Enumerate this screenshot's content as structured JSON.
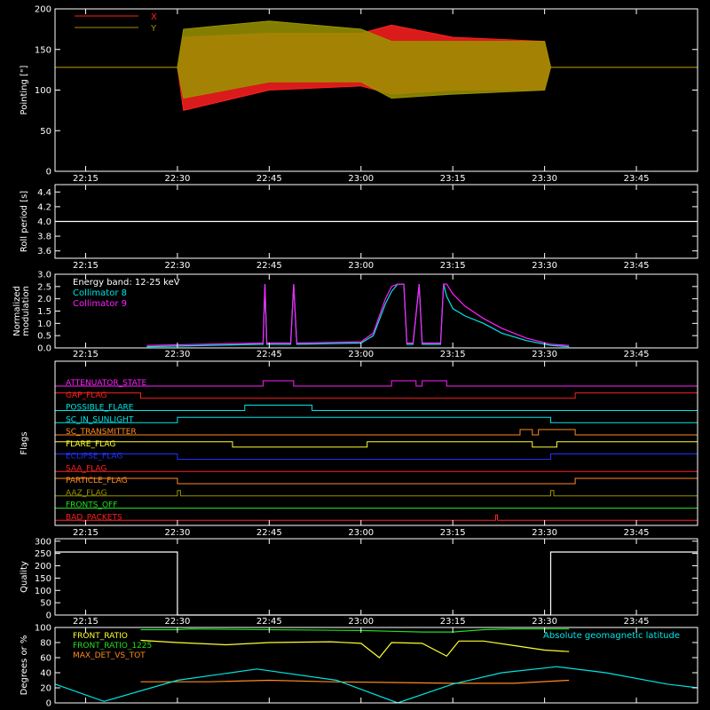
{
  "x_ticks": [
    "22:15",
    "22:30",
    "22:45",
    "23:00",
    "23:15",
    "23:30",
    "23:45"
  ],
  "colors": {
    "background": "#000000",
    "axis": "#ffffff",
    "red": "#ff2020",
    "olive": "#9a9400",
    "cyan": "#00e5e5",
    "magenta": "#ff20ff",
    "yellow": "#ffff30",
    "green": "#20e020",
    "orange": "#ff8a20",
    "blue": "#2030ff"
  },
  "chart_data": [
    {
      "id": "pointing",
      "type": "line",
      "ylabel": "Pointing [\"]",
      "ylim": [
        0,
        200
      ],
      "yticks": [
        "0",
        "50",
        "100",
        "150",
        "200"
      ],
      "x_range": [
        "22:10",
        "23:55"
      ],
      "legend": [
        {
          "name": "X",
          "color": "#ff2020"
        },
        {
          "name": "Y",
          "color": "#9a9400"
        }
      ],
      "legend_position": "top-left",
      "series": [
        {
          "name": "X",
          "color": "#ff2020",
          "x": [
            "22:10",
            "22:30",
            "22:31",
            "22:45",
            "23:00",
            "23:05",
            "23:15",
            "23:30",
            "23:31",
            "23:55"
          ],
          "ymin": [
            128,
            128,
            75,
            100,
            105,
            95,
            100,
            100,
            128,
            128
          ],
          "ymax": [
            128,
            128,
            165,
            170,
            170,
            180,
            165,
            160,
            128,
            128
          ]
        },
        {
          "name": "Y",
          "color": "#9a9400",
          "x": [
            "22:10",
            "22:30",
            "22:31",
            "22:45",
            "23:00",
            "23:05",
            "23:15",
            "23:30",
            "23:31",
            "23:55"
          ],
          "ymin": [
            128,
            128,
            90,
            110,
            110,
            90,
            95,
            100,
            128,
            128
          ],
          "ymax": [
            128,
            128,
            175,
            185,
            175,
            160,
            160,
            160,
            128,
            128
          ]
        }
      ]
    },
    {
      "id": "roll",
      "type": "line",
      "ylabel": "Roll period [s]",
      "ylim": [
        3.5,
        4.5
      ],
      "yticks": [
        "3.6",
        "3.8",
        "4.0",
        "4.2",
        "4.4"
      ],
      "series": [
        {
          "name": "",
          "color": "#ffffff",
          "x": [
            "22:10",
            "23:55"
          ],
          "y": [
            4.0,
            4.0
          ]
        }
      ]
    },
    {
      "id": "modulation",
      "type": "line",
      "ylabel": "Normalized modulation",
      "ylim": [
        0,
        3.0
      ],
      "yticks": [
        "0.0",
        "0.5",
        "1.0",
        "1.5",
        "2.0",
        "2.5",
        "3.0"
      ],
      "annotation": "Energy band: 12-25 keV",
      "legend": [
        {
          "name": "Collimator 8",
          "color": "#00e5e5"
        },
        {
          "name": "Collimator 9",
          "color": "#ff20ff"
        }
      ],
      "legend_position": "top-left",
      "series": [
        {
          "name": "Collimator 8",
          "color": "#00e5e5",
          "x": [
            "22:25",
            "22:44",
            "22:44.3",
            "22:44.6",
            "22:48.5",
            "22:49",
            "22:49.5",
            "23:00",
            "23:02",
            "23:04",
            "23:05",
            "23:06",
            "23:07",
            "23:07.5",
            "23:08.5",
            "23:09.5",
            "23:10",
            "23:11",
            "23:13",
            "23:13.5",
            "23:14",
            "23:15",
            "23:17",
            "23:20",
            "23:23",
            "23:27",
            "23:31",
            "23:34"
          ],
          "y": [
            0.05,
            0.15,
            2.6,
            0.15,
            0.15,
            2.6,
            0.15,
            0.2,
            0.5,
            1.8,
            2.3,
            2.6,
            2.6,
            0.15,
            0.15,
            2.6,
            0.15,
            0.15,
            0.15,
            2.6,
            2.1,
            1.6,
            1.3,
            1.0,
            0.6,
            0.3,
            0.1,
            0.05
          ]
        },
        {
          "name": "Collimator 9",
          "color": "#ff20ff",
          "x": [
            "22:25",
            "22:44",
            "22:44.3",
            "22:44.6",
            "22:48.5",
            "22:49",
            "22:49.5",
            "23:00",
            "23:02",
            "23:04",
            "23:05",
            "23:06",
            "23:07",
            "23:07.5",
            "23:08.5",
            "23:09.5",
            "23:10",
            "23:11",
            "23:13",
            "23:13.5",
            "23:14",
            "23:15",
            "23:17",
            "23:20",
            "23:23",
            "23:27",
            "23:31",
            "23:34"
          ],
          "y": [
            0.1,
            0.2,
            2.6,
            0.2,
            0.2,
            2.6,
            0.2,
            0.25,
            0.6,
            2.0,
            2.5,
            2.6,
            2.6,
            0.2,
            0.2,
            2.6,
            0.2,
            0.2,
            0.2,
            2.6,
            2.6,
            2.2,
            1.7,
            1.2,
            0.8,
            0.4,
            0.15,
            0.1
          ]
        }
      ]
    },
    {
      "id": "flags",
      "type": "line",
      "ylabel": "Flags",
      "flags": [
        {
          "name": "ATTENUATOR_STATE",
          "color": "#ff20ff",
          "x": [
            "22:10",
            "22:44",
            "22:44",
            "22:49",
            "22:49",
            "23:05",
            "23:05",
            "23:09",
            "23:09",
            "23:10",
            "23:10",
            "23:14",
            "23:14",
            "23:55"
          ],
          "v": [
            0,
            0,
            1,
            1,
            0,
            0,
            1,
            1,
            0,
            0,
            1,
            1,
            0,
            0
          ]
        },
        {
          "name": "GAP_FLAG",
          "color": "#ff2020",
          "x": [
            "22:10",
            "22:24",
            "22:24",
            "23:35",
            "23:35",
            "23:55"
          ],
          "v": [
            1,
            1,
            0,
            0,
            1,
            1
          ]
        },
        {
          "name": "POSSIBLE_FLARE",
          "color": "#00e5e5",
          "x": [
            "22:10",
            "22:41",
            "22:41",
            "22:52",
            "22:52",
            "23:55"
          ],
          "v": [
            0,
            0,
            1,
            1,
            0,
            0
          ]
        },
        {
          "name": "SC_IN_SUNLIGHT",
          "color": "#00e5e5",
          "x": [
            "22:10",
            "22:30",
            "22:30",
            "23:31",
            "23:31",
            "23:55"
          ],
          "v": [
            0,
            0,
            1,
            1,
            0,
            0
          ]
        },
        {
          "name": "SC_TRANSMITTER",
          "color": "#ff8a20",
          "x": [
            "22:10",
            "23:26",
            "23:26",
            "23:28",
            "23:28",
            "23:29",
            "23:29",
            "23:35",
            "23:35",
            "23:55"
          ],
          "v": [
            0,
            0,
            1,
            1,
            0,
            0,
            1,
            1,
            0,
            0
          ]
        },
        {
          "name": "FLARE_FLAG",
          "color": "#ffff30",
          "x": [
            "22:10",
            "22:39",
            "22:39",
            "23:01",
            "23:01",
            "23:28",
            "23:28",
            "23:32",
            "23:32",
            "23:55"
          ],
          "v": [
            1,
            1,
            0,
            0,
            1,
            1,
            0,
            0,
            1,
            1
          ]
        },
        {
          "name": "ECLIPSE_FLAG",
          "color": "#2030ff",
          "x": [
            "22:10",
            "22:30",
            "22:30",
            "23:31",
            "23:31",
            "23:55"
          ],
          "v": [
            1,
            1,
            0,
            0,
            1,
            1
          ]
        },
        {
          "name": "SAA_FLAG",
          "color": "#ff2020",
          "x": [
            "22:10",
            "23:55"
          ],
          "v": [
            0,
            0
          ]
        },
        {
          "name": "PARTICLE_FLAG",
          "color": "#ff8a20",
          "x": [
            "22:10",
            "22:30",
            "22:30",
            "23:35",
            "23:35",
            "23:55"
          ],
          "v": [
            1,
            1,
            0,
            0,
            1,
            1
          ]
        },
        {
          "name": "AAZ_FLAG",
          "color": "#9a9400",
          "x": [
            "22:10",
            "22:30",
            "22:30",
            "22:30.5",
            "22:30.5",
            "23:31",
            "23:31",
            "23:31.5",
            "23:31.5",
            "23:55"
          ],
          "v": [
            0,
            0,
            1,
            1,
            0,
            0,
            1,
            1,
            0,
            0
          ]
        },
        {
          "name": "FRONTS_OFF",
          "color": "#20e020",
          "x": [
            "22:10",
            "23:55"
          ],
          "v": [
            0,
            0
          ]
        },
        {
          "name": "BAD_PACKETS",
          "color": "#ff2020",
          "x": [
            "22:10",
            "23:22",
            "23:22",
            "23:22.3",
            "23:22.3",
            "23:55"
          ],
          "v": [
            0,
            0,
            1,
            1,
            0,
            0
          ]
        }
      ]
    },
    {
      "id": "quality",
      "type": "line",
      "ylabel": "Quality",
      "ylim": [
        0,
        310
      ],
      "yticks": [
        "0",
        "50",
        "100",
        "150",
        "200",
        "250",
        "300"
      ],
      "series": [
        {
          "name": "",
          "color": "#ffffff",
          "x": [
            "22:10",
            "22:30",
            "22:30",
            "23:31",
            "23:31",
            "23:55"
          ],
          "y": [
            256,
            256,
            0,
            0,
            256,
            256
          ]
        }
      ]
    },
    {
      "id": "ratios",
      "type": "line",
      "ylabel": "Degrees or %",
      "ylim": [
        0,
        100
      ],
      "yticks": [
        "0",
        "20",
        "40",
        "60",
        "80",
        "100"
      ],
      "legend": [
        {
          "name": "FRONT_RATIO",
          "color": "#ffff30"
        },
        {
          "name": "FRONT_RATIO_1225",
          "color": "#20e020"
        },
        {
          "name": "MAX_DET_VS_TOT",
          "color": "#ff8a20"
        }
      ],
      "legend_position": "top-left",
      "annotation": "Absolute geomagnetic latitude",
      "series": [
        {
          "name": "FRONT_RATIO",
          "color": "#ffff30",
          "x": [
            "22:24",
            "22:30",
            "22:38",
            "22:45",
            "22:55",
            "23:00",
            "23:03",
            "23:05",
            "23:10",
            "23:14",
            "23:16",
            "23:20",
            "23:25",
            "23:30",
            "23:34"
          ],
          "y": [
            83,
            80,
            77,
            80,
            81,
            79,
            60,
            80,
            79,
            62,
            82,
            82,
            76,
            70,
            68
          ]
        },
        {
          "name": "FRONT_RATIO_1225",
          "color": "#20e020",
          "x": [
            "22:24",
            "22:30",
            "22:32",
            "23:00",
            "23:05",
            "23:10",
            "23:15",
            "23:20",
            "23:25",
            "23:30",
            "23:34"
          ],
          "y": [
            97,
            97,
            98,
            96,
            95,
            94,
            94,
            97,
            98,
            98,
            98
          ]
        },
        {
          "name": "MAX_DET_VS_TOT",
          "color": "#ff8a20",
          "x": [
            "22:24",
            "22:35",
            "22:45",
            "22:55",
            "23:05",
            "23:15",
            "23:25",
            "23:34"
          ],
          "y": [
            28,
            28,
            30,
            28,
            27,
            26,
            26,
            30
          ]
        },
        {
          "name": "Absolute geomagnetic latitude",
          "color": "#00e5e5",
          "x": [
            "22:10",
            "22:18",
            "22:30",
            "22:43",
            "22:56",
            "23:06",
            "23:15",
            "23:23",
            "23:32",
            "23:40",
            "23:50",
            "23:55"
          ],
          "y": [
            25,
            2,
            30,
            45,
            30,
            0,
            25,
            40,
            48,
            40,
            25,
            20
          ]
        }
      ]
    }
  ]
}
